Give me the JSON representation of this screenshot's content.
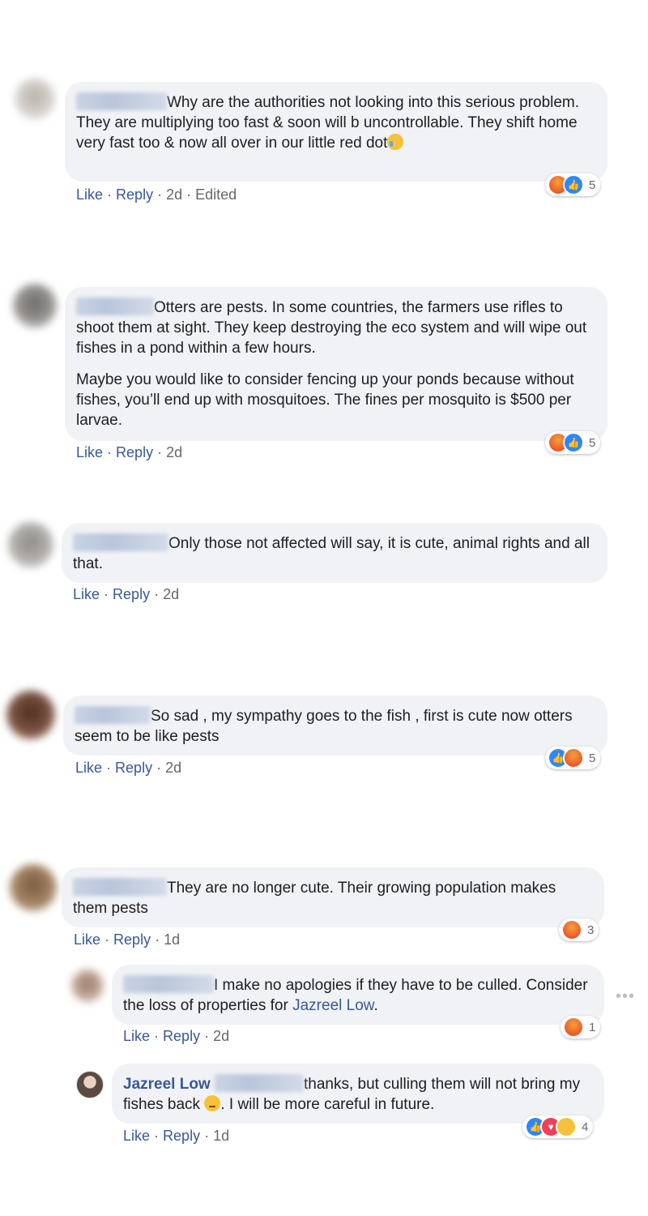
{
  "actions": {
    "like": "Like",
    "reply": "Reply"
  },
  "comments": [
    {
      "text": "Why are the authorities not looking into this serious problem. They are multiplying too fast & soon will b uncontrollable. They shift home very fast too & now all over in our little red dot",
      "time": "2d",
      "edited": "Edited",
      "reaction_icons": [
        "angry-icon",
        "like-icon"
      ],
      "reaction_count": "5"
    },
    {
      "paragraphs": [
        "Otters are pests. In some countries, the farmers use rifles to shoot them at sight. They keep destroying the eco system and will wipe out fishes in a pond within a few hours.",
        "Maybe you would like to consider fencing up your ponds because without fishes, you’ll end up with mosquitoes. The fines per mosquito is $500 per larvae."
      ],
      "time": "2d",
      "reaction_icons": [
        "angry-icon",
        "like-icon"
      ],
      "reaction_count": "5"
    },
    {
      "text": "Only those not affected will say, it is cute, animal rights and all that.",
      "time": "2d"
    },
    {
      "text": "So sad , my sympathy goes to the fish , first is cute now otters seem to be like pests",
      "time": "2d",
      "reaction_icons": [
        "like-icon",
        "angry-icon"
      ],
      "reaction_count": "5"
    },
    {
      "text": "They are no longer cute. Their growing population makes them pests",
      "time": "1d",
      "reaction_icons": [
        "angry-icon"
      ],
      "reaction_count": "3",
      "replies": [
        {
          "text": "I make no apologies if they have to be culled. Consider the loss of properties for ",
          "mention": "Jazreel Low",
          "text_end": ".",
          "time": "2d",
          "reaction_icons": [
            "angry-icon"
          ],
          "reaction_count": "1"
        },
        {
          "author": "Jazreel Low",
          "text": "thanks, but culling them will not bring my fishes back ",
          "text_end": ". I will be more careful in future.",
          "time": "1d",
          "reaction_icons": [
            "like-icon",
            "love-icon",
            "sad-icon"
          ],
          "reaction_count": "4"
        }
      ]
    }
  ],
  "more_options_icon": "more-horizontal-icon",
  "colors": {
    "bubble": "#f0f2f5",
    "link": "#385898",
    "meta": "#65676b"
  }
}
